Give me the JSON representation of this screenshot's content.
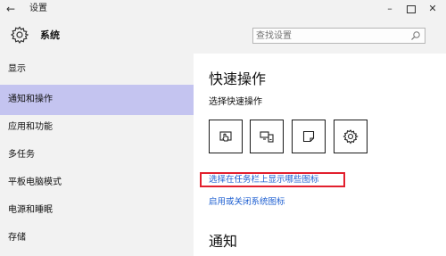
{
  "titlebar": {
    "back_glyph": "←",
    "title": "设置",
    "minimize_glyph": "–",
    "close_glyph": "✕"
  },
  "header": {
    "app_title": "系统",
    "search_placeholder": "查找设置",
    "icons": [
      "gear-icon",
      "search-icon"
    ]
  },
  "sidebar": {
    "items": [
      {
        "label": "显示",
        "selected": false
      },
      {
        "label": "通知和操作",
        "selected": true
      },
      {
        "label": "应用和功能",
        "selected": false
      },
      {
        "label": "多任务",
        "selected": false
      },
      {
        "label": "平板电脑模式",
        "selected": false
      },
      {
        "label": "电源和睡眠",
        "selected": false
      },
      {
        "label": "存储",
        "selected": false
      }
    ]
  },
  "main": {
    "title": "快速操作",
    "subtitle": "选择快速操作",
    "quick_actions": [
      "tablet-mode-icon",
      "connect-icon",
      "note-icon",
      "settings-icon"
    ],
    "link1": "选择在任务栏上显示哪些图标",
    "link2": "启用或关闭系统图标",
    "section2_title": "通知"
  },
  "colors": {
    "sidebar_bg": "#f2f2f2",
    "selected_bg": "#c4c4f0",
    "link": "#1e5fd1",
    "highlight_border": "#e2202e"
  }
}
